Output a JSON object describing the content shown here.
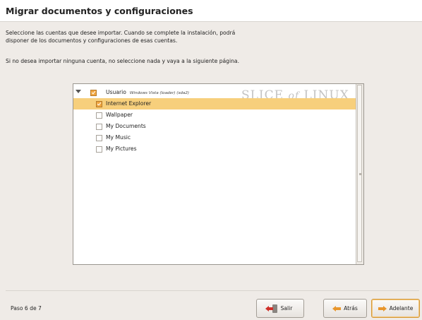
{
  "header": {
    "title": "Migrar documentos y configuraciones"
  },
  "intro": {
    "line1": "Seleccione las cuentas que desee importar. Cuando se complete la instalación, podrá",
    "line2": "disponer de los documentos y configuraciones de esas cuentas.",
    "line3": "Si no desea importar ninguna cuenta, no seleccione nada y vaya a la siguiente página."
  },
  "tree": {
    "user": {
      "label": "Usuario",
      "detail": "Windows Vista (loader) (sda2)",
      "checked": true
    },
    "items": [
      {
        "label": "Internet Explorer",
        "checked": true,
        "selected": true
      },
      {
        "label": "Wallpaper",
        "checked": false,
        "selected": false
      },
      {
        "label": "My Documents",
        "checked": false,
        "selected": false
      },
      {
        "label": "My Music",
        "checked": false,
        "selected": false
      },
      {
        "label": "My Pictures",
        "checked": false,
        "selected": false
      }
    ]
  },
  "watermark": {
    "part1": "SLICE",
    "part2": "of",
    "part3": "LINUX"
  },
  "footer": {
    "step": "Paso 6 de 7",
    "quit_label": "Salir",
    "back_label": "Atrás",
    "forward_label": "Adelante"
  },
  "colors": {
    "selection": "#f7cf7c",
    "accent": "#e8962c"
  },
  "icons": {
    "quit": "exit-icon",
    "back": "arrow-left-icon",
    "forward": "arrow-right-icon",
    "expander": "expander-arrow-icon"
  }
}
